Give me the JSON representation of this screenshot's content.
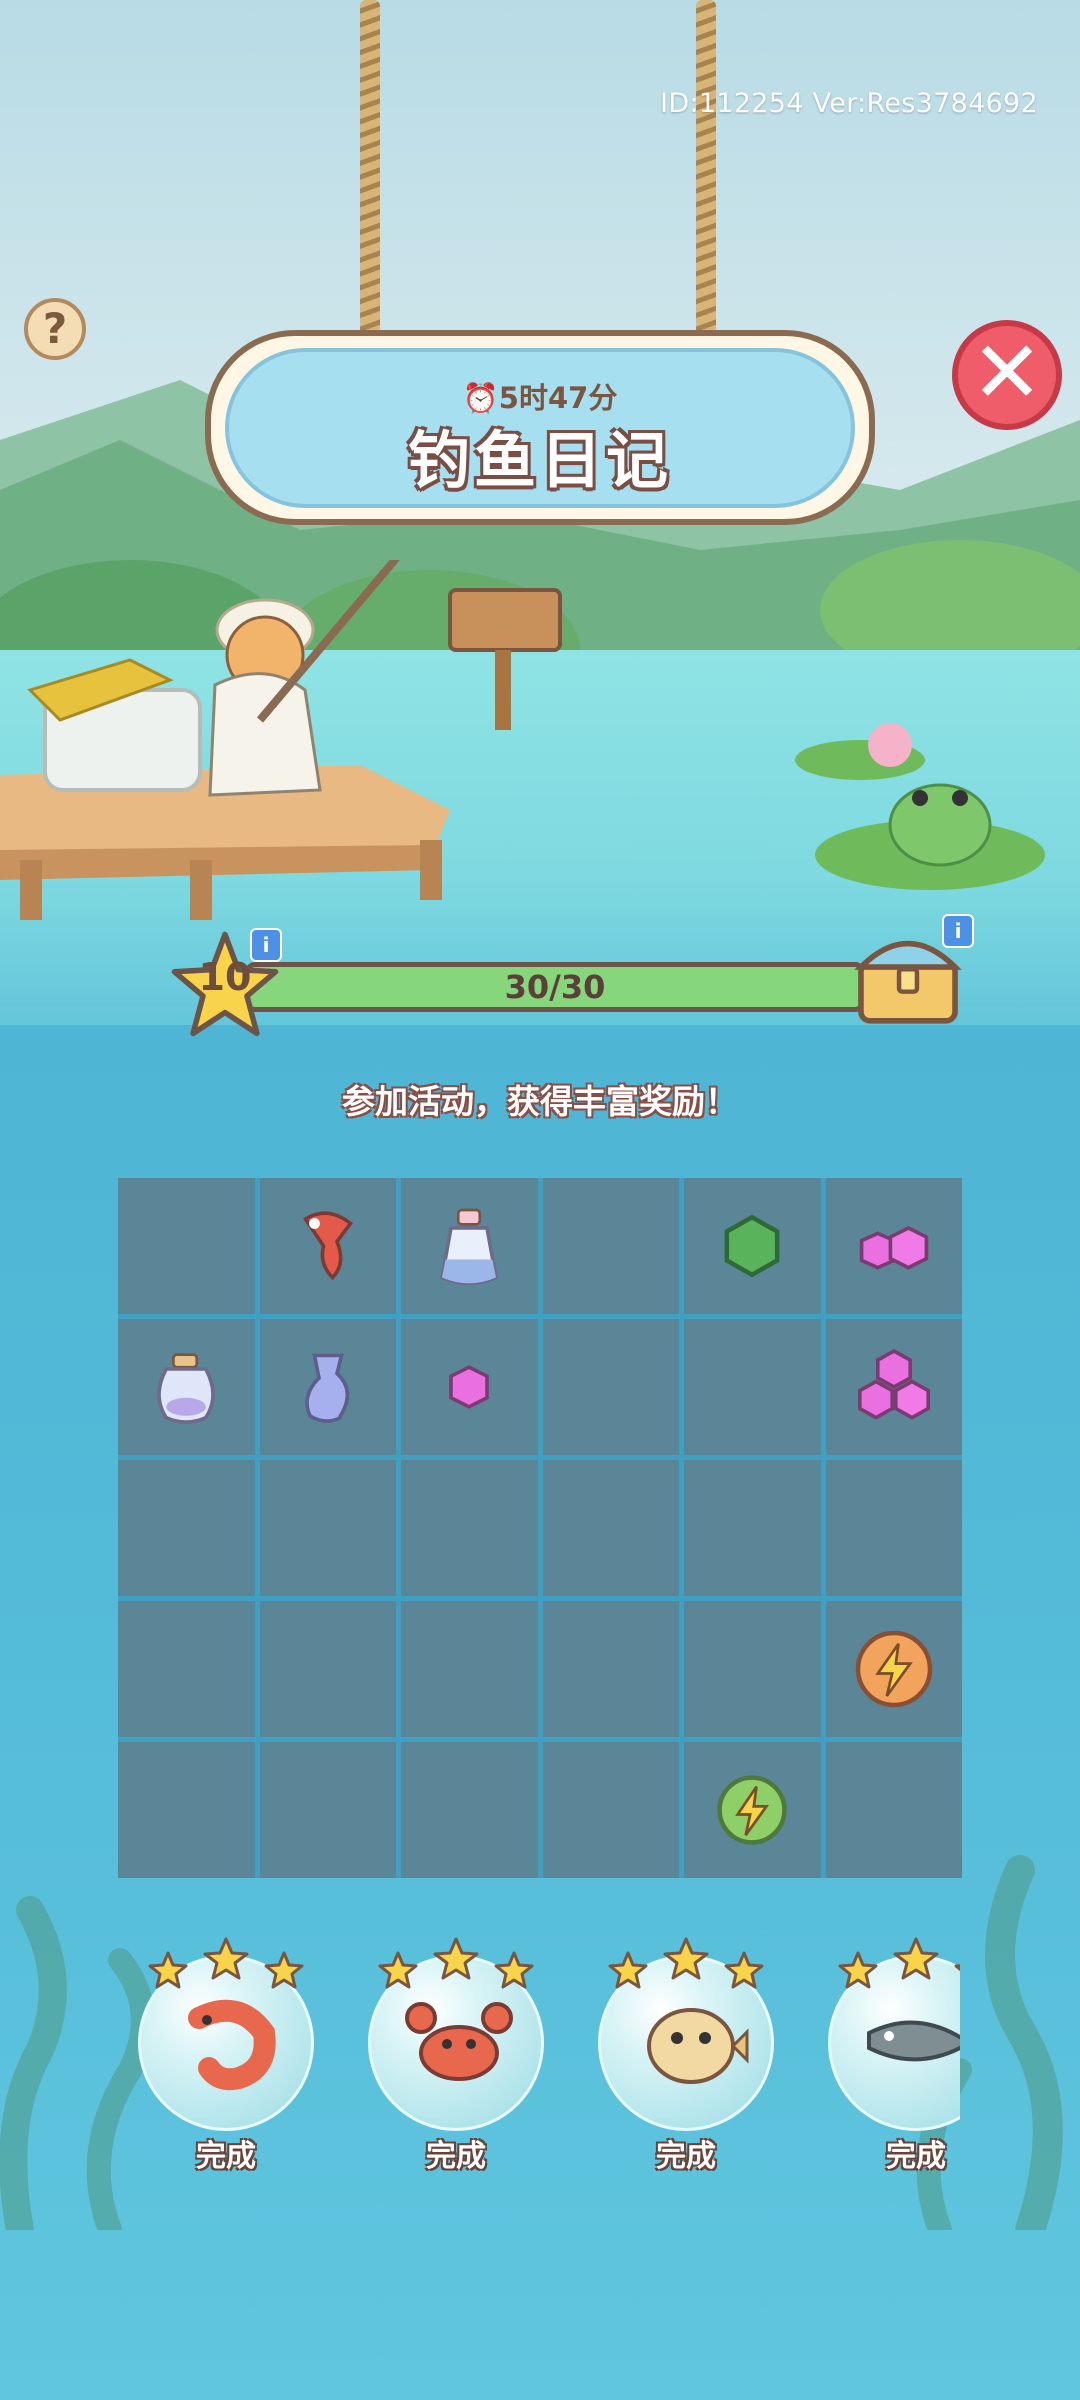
{
  "header": {
    "id_version": "ID:112254  Ver:Res3784692",
    "help_icon": "question-icon",
    "close_icon": "close-icon"
  },
  "event": {
    "timer": "5时47分",
    "title": "钓鱼日记",
    "subtitle": "参加活动，获得丰富奖励！"
  },
  "progress": {
    "level": "10",
    "text": "30/30",
    "fraction": 1.0,
    "info_label": "i"
  },
  "grid": {
    "rows": [
      [
        "",
        "koi-fish",
        "potion-bottle",
        "",
        "green-gem",
        "pink-gems-2"
      ],
      [
        "potion-bottle-small",
        "blue-bottle",
        "pink-gem",
        "",
        "",
        "pink-gems-3"
      ],
      [
        "",
        "",
        "",
        "",
        "",
        ""
      ],
      [
        "",
        "",
        "",
        "",
        "",
        "energy-orange"
      ],
      [
        "",
        "",
        "",
        "",
        "energy-green",
        ""
      ]
    ]
  },
  "collection": [
    {
      "icon": "shrimp-icon",
      "label": "完成"
    },
    {
      "icon": "crab-icon",
      "label": "完成"
    },
    {
      "icon": "pufferfish-icon",
      "label": "完成"
    },
    {
      "icon": "catfish-icon",
      "label": "完成"
    }
  ],
  "colors": {
    "water": "#53bad8",
    "progress_fill": "#86d67b",
    "close": "#ef5d6a",
    "grid_cell": "#5a8698"
  }
}
